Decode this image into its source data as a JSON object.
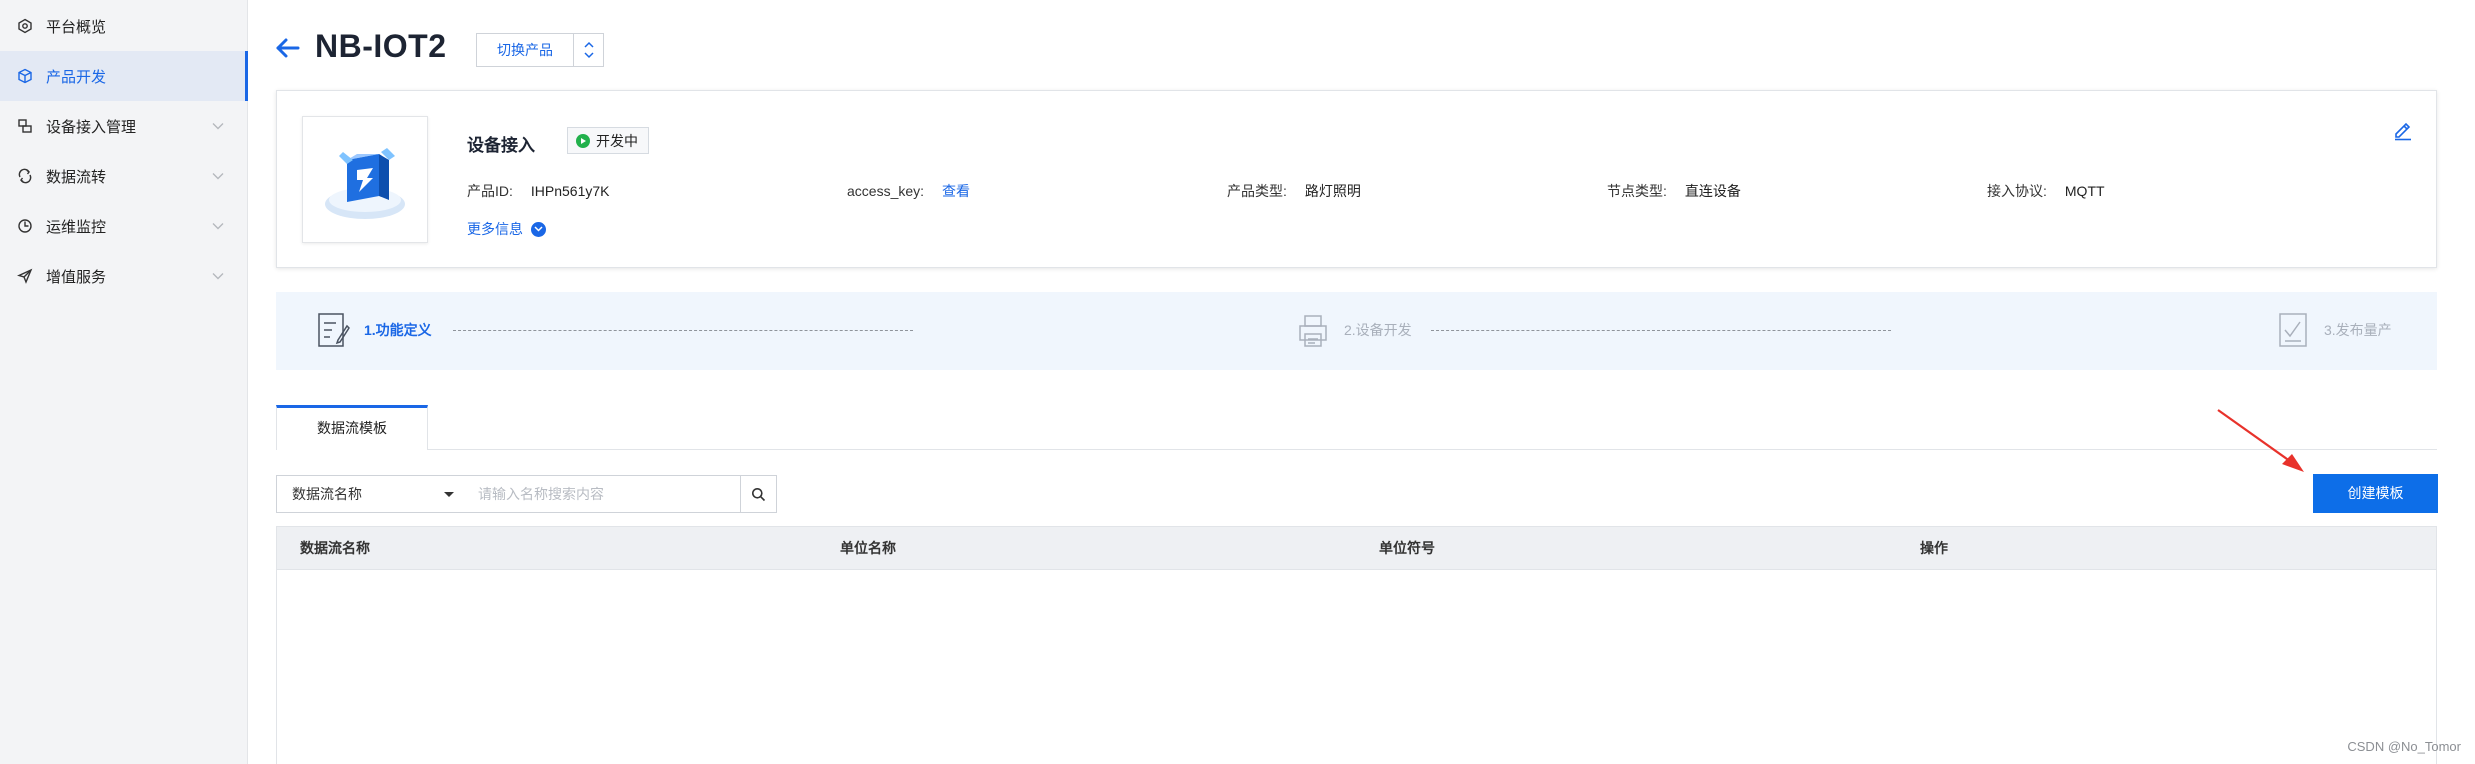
{
  "sidebar": {
    "items": [
      {
        "label": "平台概览",
        "icon": "dashboard-icon",
        "has_chevron": false
      },
      {
        "label": "产品开发",
        "icon": "cube-icon",
        "has_chevron": false,
        "active": true
      },
      {
        "label": "设备接入管理",
        "icon": "device-icon",
        "has_chevron": true
      },
      {
        "label": "数据流转",
        "icon": "flow-icon",
        "has_chevron": true
      },
      {
        "label": "运维监控",
        "icon": "monitor-icon",
        "has_chevron": true
      },
      {
        "label": "增值服务",
        "icon": "send-icon",
        "has_chevron": true
      }
    ]
  },
  "header": {
    "title": "NB-IOT2",
    "switch_label": "切换产品"
  },
  "product": {
    "name": "设备接入",
    "status": "开发中",
    "fields": {
      "product_id_label": "产品ID:",
      "product_id_value": "IHPn561y7K",
      "access_key_label": "access_key:",
      "access_key_link": "查看",
      "type_label": "产品类型:",
      "type_value": "路灯照明",
      "node_label": "节点类型:",
      "node_value": "直连设备",
      "protocol_label": "接入协议:",
      "protocol_value": "MQTT"
    },
    "more_info": "更多信息"
  },
  "steps": [
    {
      "label": "1.功能定义",
      "state": "active"
    },
    {
      "label": "2.设备开发",
      "state": "inactive"
    },
    {
      "label": "3.发布量产",
      "state": "inactive"
    }
  ],
  "tabs": {
    "active": "数据流模板"
  },
  "search": {
    "select_value": "数据流名称",
    "placeholder": "请输入名称搜索内容"
  },
  "create_button": "创建模板",
  "table": {
    "columns": [
      "数据流名称",
      "单位名称",
      "单位符号",
      "操作"
    ],
    "rows": []
  },
  "watermark": "CSDN @No_Tomor",
  "colors": {
    "accent": "#1a67e6",
    "primary_button": "#0d6ee8",
    "status_green": "#22b14c",
    "annotation_red": "#e8322b"
  }
}
